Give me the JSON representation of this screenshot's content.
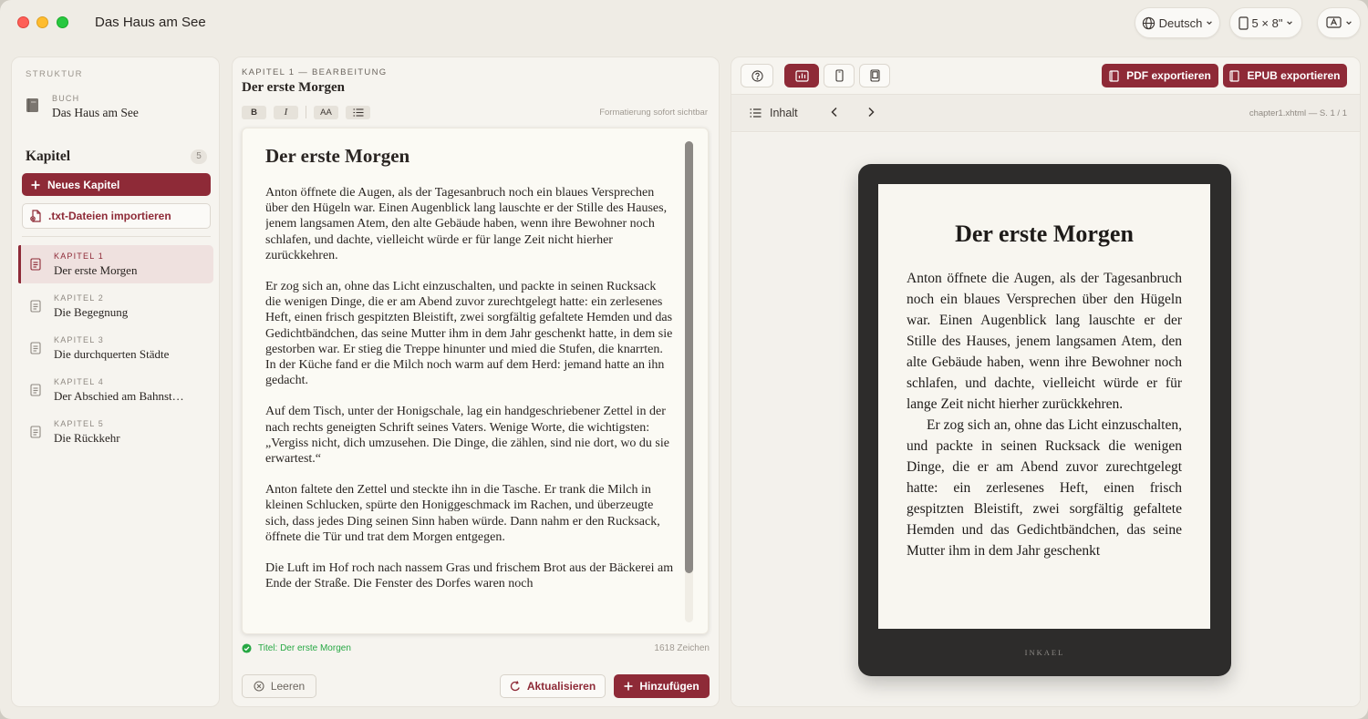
{
  "app": {
    "title": "Das Haus am See",
    "language": "Deutsch",
    "trim_size": "5 × 8\""
  },
  "colors": {
    "accent": "#8e2a37",
    "success": "#27a844",
    "background": "#efece5"
  },
  "sidebar": {
    "section_label": "STRUKTUR",
    "book_kind": "BUCH",
    "book_title": "Das Haus am See",
    "chapters_heading": "Kapitel",
    "chapter_count": "5",
    "new_chapter_label": "Neues Kapitel",
    "import_label": ".txt-Dateien importieren",
    "chapters": [
      {
        "num": "KAPITEL 1",
        "title": "Der erste Morgen",
        "active": true
      },
      {
        "num": "KAPITEL 2",
        "title": "Die Begegnung",
        "active": false
      },
      {
        "num": "KAPITEL 3",
        "title": "Die durchquerten Städte",
        "active": false
      },
      {
        "num": "KAPITEL 4",
        "title": "Der Abschied am Bahnst…",
        "active": false
      },
      {
        "num": "KAPITEL 5",
        "title": "Die Rückkehr",
        "active": false
      }
    ]
  },
  "editor": {
    "kicker": "KAPITEL 1 — BEARBEITUNG",
    "title": "Der erste Morgen",
    "format_buttons": {
      "bold": "B",
      "italic": "I",
      "size": "AA"
    },
    "format_hint": "Formatierung sofort sichtbar",
    "content_title": "Der erste Morgen",
    "paragraphs": [
      "Anton öffnete die Augen, als der Tagesanbruch noch ein blaues Versprechen über den Hügeln war. Einen Augenblick lang lauschte er der Stille des Hauses, jenem langsamen Atem, den alte Gebäude haben, wenn ihre Bewohner noch schlafen, und dachte, vielleicht würde er für lange Zeit nicht hierher zurückkehren.",
      "Er zog sich an, ohne das Licht einzuschalten, und packte in seinen Rucksack die wenigen Dinge, die er am Abend zuvor zurechtgelegt hatte: ein zerlesenes Heft, einen frisch gespitzten Bleistift, zwei sorgfältig gefaltete Hemden und das Gedichtbändchen, das seine Mutter ihm in dem Jahr geschenkt hatte, in dem sie gestorben war. Er stieg die Treppe hinunter und mied die Stufen, die knarrten. In der Küche fand er die Milch noch warm auf dem Herd: jemand hatte an ihn gedacht.",
      "Auf dem Tisch, unter der Honigschale, lag ein handgeschriebener Zettel in der nach rechts geneigten Schrift seines Vaters. Wenige Worte, die wichtigsten: „Vergiss nicht, dich umzusehen. Die Dinge, die zählen, sind nie dort, wo du sie erwartest.“",
      "Anton faltete den Zettel und steckte ihn in die Tasche. Er trank die Milch in kleinen Schlucken, spürte den Honiggeschmack im Rachen, und überzeugte sich, dass jedes Ding seinen Sinn haben würde. Dann nahm er den Rucksack, öffnete die Tür und trat dem Morgen entgegen.",
      "Die Luft im Hof roch nach nassem Gras und frischem Brot aus der Bäckerei am Ende der Straße. Die Fenster des Dorfes waren noch"
    ],
    "status_text": "Titel: Der erste Morgen",
    "char_count": "1618 Zeichen",
    "clear_label": "Leeren",
    "refresh_label": "Aktualisieren",
    "add_label": "Hinzufügen"
  },
  "preview": {
    "pdf_label": "PDF exportieren",
    "epub_label": "EPUB exportieren",
    "toc_label": "Inhalt",
    "file_info": "chapter1.xhtml — S. 1 / 1",
    "screen_title": "Der erste Morgen",
    "screen_paragraphs": [
      "Anton öffnete die Augen, als der Tagesan­bruch noch ein blaues Versprechen über den Hügeln war. Einen Augenblick lang lauschte er der Stille des Hauses, jenem langsamen Atem, den alte Gebäude haben, wenn ihre Bewohner noch schlafen, und dachte, viel­leicht würde er für lange Zeit nicht hierher zurückkehren.",
      "Er zog sich an, ohne das Licht einzu­schalten, und packte in seinen Rucksack die wenigen Dinge, die er am Abend zuvor zu­rechtgelegt hatte: ein zerlesenes Heft, einen frisch gespitzten Bleistift, zwei sorgfältig ge­faltete Hemden und das Gedichtbändchen, das seine Mutter ihm in dem Jahr geschenkt"
    ],
    "device_brand": "INKAEL"
  }
}
